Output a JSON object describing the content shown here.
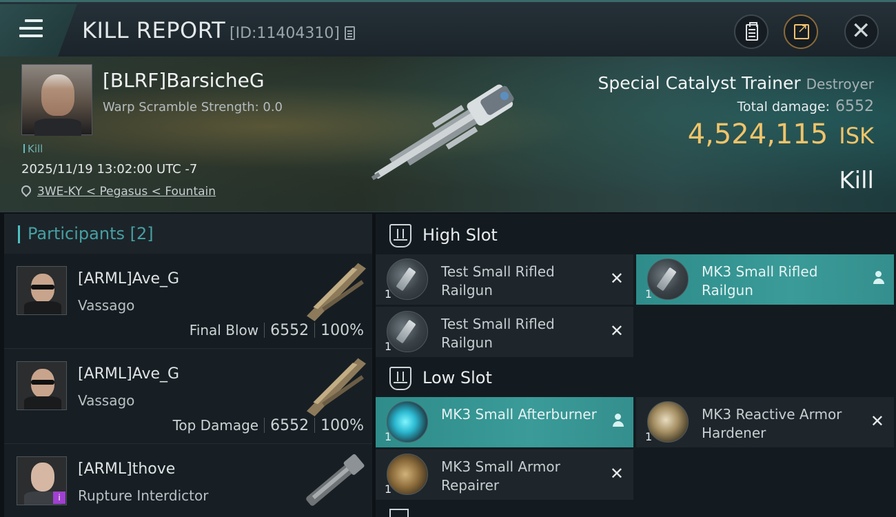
{
  "header": {
    "title": "KILL REPORT",
    "report_id": "[ID:11404310]"
  },
  "victim": {
    "name": "[BLRF]BarsicheG",
    "warp_scramble": "Warp Scramble Strength: 0.0",
    "tag": "Kill",
    "datetime": "2025/11/19 13:02:00 UTC -7",
    "location": "3WE-KY < Pegasus < Fountain",
    "ship_name": "Special Catalyst Trainer",
    "ship_class": "Destroyer",
    "total_damage_label": "Total damage:",
    "total_damage": "6552",
    "isk_value": "4,524,115",
    "isk_unit": "ISK",
    "result": "Kill"
  },
  "participants": {
    "title": "Participants",
    "count": "[2]",
    "rows": [
      {
        "name": "[ARML]Ave_G",
        "ship": "Vassago",
        "role": "Final Blow",
        "damage": "6552",
        "percent": "100%"
      },
      {
        "name": "[ARML]Ave_G",
        "ship": "Vassago",
        "role": "Top Damage",
        "damage": "6552",
        "percent": "100%"
      },
      {
        "name": "[ARML]thove",
        "ship": "Rupture Interdictor",
        "badge": "i"
      }
    ]
  },
  "fitting": {
    "high_slot": "High Slot",
    "low_slot": "Low Slot",
    "high": [
      {
        "name": "Test Small Rifled Railgun",
        "qty": "1",
        "status": "destroyed"
      },
      {
        "name": "MK3 Small Rifled Railgun",
        "qty": "1",
        "status": "dropped"
      },
      {
        "name": "Test Small Rifled Railgun",
        "qty": "1",
        "status": "destroyed"
      }
    ],
    "low": [
      {
        "name": "MK3 Small Afterburner",
        "qty": "1",
        "status": "dropped"
      },
      {
        "name": "MK3 Reactive Armor Hardener",
        "qty": "1",
        "status": "destroyed"
      },
      {
        "name": "MK3 Small Armor Repairer",
        "qty": "1",
        "status": "destroyed"
      }
    ],
    "destroyed_symbol": "✕"
  },
  "icons": {
    "menu": "hamburger-menu-icon",
    "copy": "copy-icon",
    "clipboard": "clipboard-icon",
    "share": "share-icon",
    "close": "close-icon",
    "close_glyph": "✕",
    "location": "location-pin-icon",
    "slot": "slot-icon",
    "user": "user-icon"
  },
  "colors": {
    "accent": "#4fc2c2",
    "isk": "#f1c46a",
    "active_module": "#3a9b98",
    "badge": "#a040d0"
  }
}
